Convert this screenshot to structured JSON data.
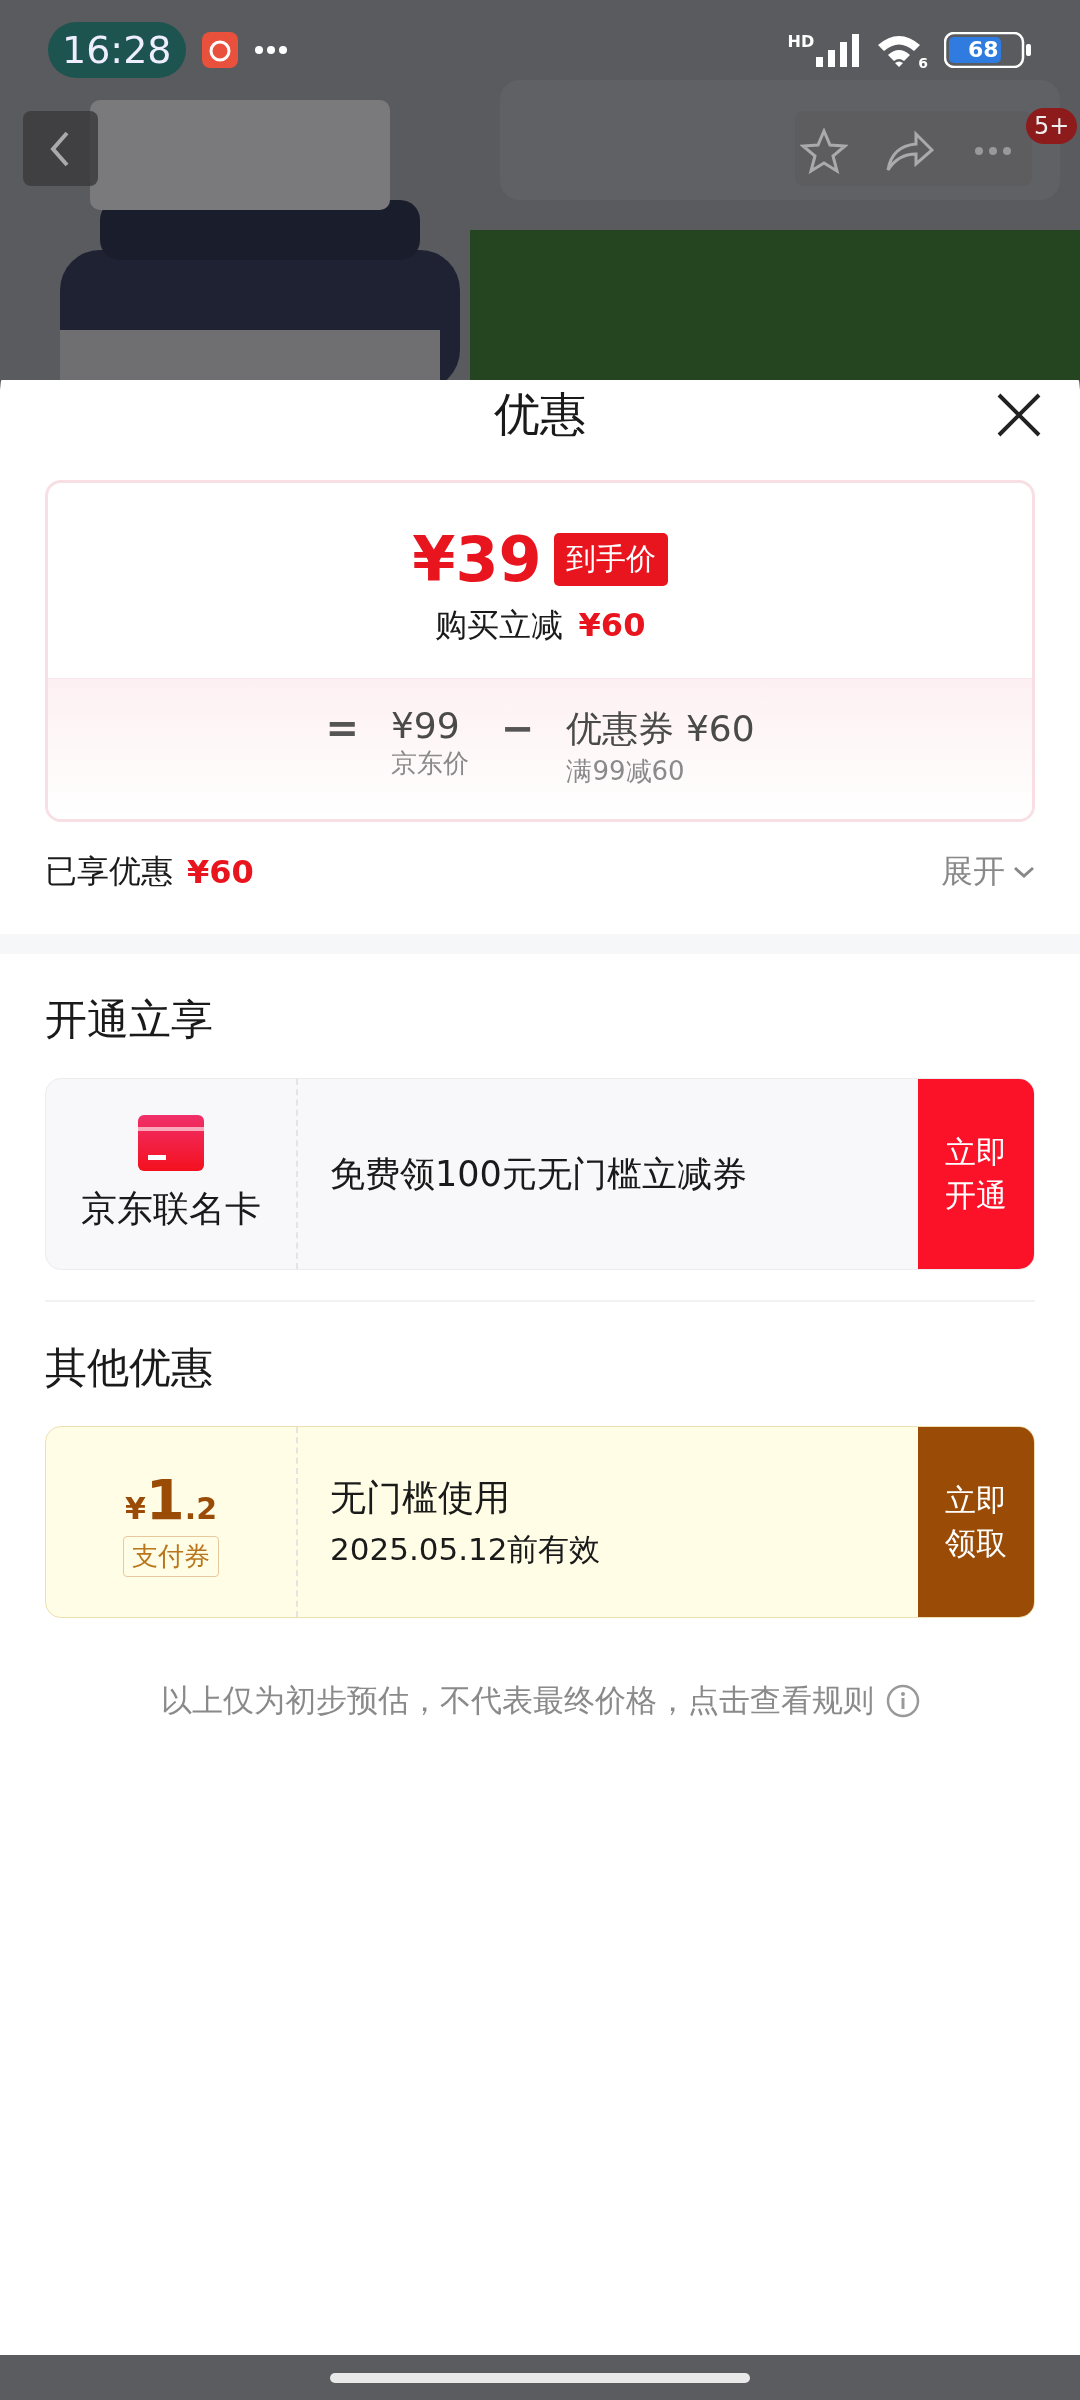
{
  "status_bar": {
    "time": "16:28",
    "network_label": "HD",
    "wifi_label": "6",
    "battery": "68"
  },
  "nav": {
    "badge": "5+"
  },
  "sheet": {
    "title": "优惠"
  },
  "price_card": {
    "final_price": "¥39",
    "final_price_tag": "到手价",
    "saving_label": "购买立减",
    "saving_amount": "¥60",
    "formula": [
      {
        "kind": "sign",
        "text": "="
      },
      {
        "kind": "term",
        "amount": "¥99",
        "note": "京东价"
      },
      {
        "kind": "sign",
        "text": "−"
      },
      {
        "kind": "term",
        "amount": "优惠券 ¥60",
        "note": "满99减60"
      }
    ]
  },
  "summary": {
    "label": "已享优惠",
    "amount": "¥60",
    "expand": "展开"
  },
  "sections": [
    {
      "title": "开通立享",
      "offers": [
        {
          "kind": "card",
          "name": "京东联名卡",
          "text": "免费领100元无门槛立减券",
          "action": "立即开通"
        }
      ]
    },
    {
      "title": "其他优惠",
      "offers": [
        {
          "kind": "coupon",
          "currency": "¥",
          "amount": "1",
          "decimal": ".2",
          "tag": "支付券",
          "title": "无门槛使用",
          "validity": "2025.05.12前有效",
          "action": "立即领取"
        }
      ]
    }
  ],
  "footer_note": "以上仅为初步预估，不代表最终价格，点击查看规则"
}
